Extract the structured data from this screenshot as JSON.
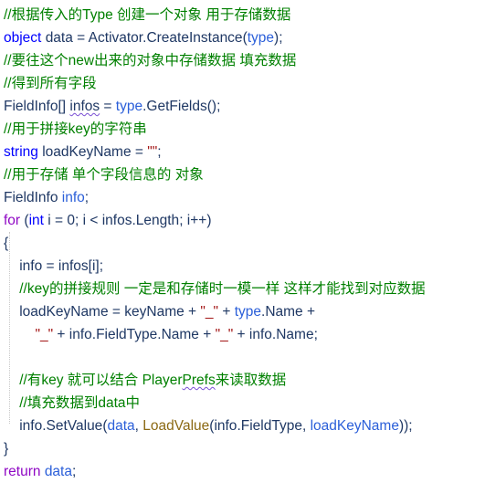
{
  "editor": {
    "language": "csharp",
    "background_color": "#ffffff",
    "colors": {
      "comment": "#008000",
      "keyword": "#0000ff",
      "control_keyword": "#8f08c4",
      "identifier": "#1f3864",
      "type_reference": "#2b5fd9",
      "string_literal": "#a31515",
      "method_call": "#8b6914",
      "squiggle_underline": "#7a4fd4",
      "indent_guide": "#c8c8c8"
    },
    "lines": [
      {
        "n": 1,
        "indent": 0,
        "text": "//根据传入的Type 创建一个对象 用于存储数据",
        "tokens": [
          {
            "t": "//根据传入的Type 创建一个对象 用于存储数据",
            "k": "cmt"
          }
        ]
      },
      {
        "n": 2,
        "indent": 0,
        "text": "object data = Activator.CreateInstance(type);",
        "tokens": [
          {
            "t": "object",
            "k": "kw"
          },
          {
            "t": " ",
            "k": "plain"
          },
          {
            "t": "data",
            "k": "id"
          },
          {
            "t": " = ",
            "k": "plain"
          },
          {
            "t": "Activator",
            "k": "type"
          },
          {
            "t": ".",
            "k": "punct"
          },
          {
            "t": "CreateInstance",
            "k": "id"
          },
          {
            "t": "(",
            "k": "punct"
          },
          {
            "t": "type",
            "k": "ltblue"
          },
          {
            "t": ");",
            "k": "punct"
          }
        ]
      },
      {
        "n": 3,
        "indent": 0,
        "text": "//要往这个new出来的对象中存储数据 填充数据",
        "tokens": [
          {
            "t": "//要往这个new出来的对象中存储数据 填充数据",
            "k": "cmt"
          }
        ]
      },
      {
        "n": 4,
        "indent": 0,
        "text": "//得到所有字段",
        "tokens": [
          {
            "t": "//得到所有字段",
            "k": "cmt"
          }
        ]
      },
      {
        "n": 5,
        "indent": 0,
        "text": "FieldInfo[] infos = type.GetFields();",
        "tokens": [
          {
            "t": "FieldInfo",
            "k": "type"
          },
          {
            "t": "[] ",
            "k": "punct"
          },
          {
            "t": "infos",
            "k": "id",
            "squiggle": true
          },
          {
            "t": " = ",
            "k": "plain"
          },
          {
            "t": "type",
            "k": "ltblue"
          },
          {
            "t": ".",
            "k": "punct"
          },
          {
            "t": "GetFields",
            "k": "id"
          },
          {
            "t": "();",
            "k": "punct"
          }
        ]
      },
      {
        "n": 6,
        "indent": 0,
        "text": "//用于拼接key的字符串",
        "tokens": [
          {
            "t": "//用于拼接key的字符串",
            "k": "cmt"
          }
        ]
      },
      {
        "n": 7,
        "indent": 0,
        "text": "string loadKeyName = \"\";",
        "tokens": [
          {
            "t": "string",
            "k": "kw"
          },
          {
            "t": " ",
            "k": "plain"
          },
          {
            "t": "loadKeyName",
            "k": "id"
          },
          {
            "t": " = ",
            "k": "plain"
          },
          {
            "t": "\"\"",
            "k": "str"
          },
          {
            "t": ";",
            "k": "punct"
          }
        ]
      },
      {
        "n": 8,
        "indent": 0,
        "text": "//用于存储 单个字段信息的 对象",
        "tokens": [
          {
            "t": "//用于存储 单个字段信息的 对象",
            "k": "cmt"
          }
        ]
      },
      {
        "n": 9,
        "indent": 0,
        "text": "FieldInfo info;",
        "tokens": [
          {
            "t": "FieldInfo",
            "k": "type"
          },
          {
            "t": " ",
            "k": "plain"
          },
          {
            "t": "info",
            "k": "ltblue"
          },
          {
            "t": ";",
            "k": "punct"
          }
        ]
      },
      {
        "n": 10,
        "indent": 0,
        "text": "for (int i = 0; i < infos.Length; i++)",
        "tokens": [
          {
            "t": "for",
            "k": "ctl"
          },
          {
            "t": " (",
            "k": "punct"
          },
          {
            "t": "int",
            "k": "kw"
          },
          {
            "t": " i = 0; i < ",
            "k": "plain"
          },
          {
            "t": "infos",
            "k": "id"
          },
          {
            "t": ".",
            "k": "punct"
          },
          {
            "t": "Length",
            "k": "id"
          },
          {
            "t": "; i++)",
            "k": "plain"
          }
        ]
      },
      {
        "n": 11,
        "indent": 0,
        "text": "{",
        "tokens": [
          {
            "t": "{",
            "k": "punct"
          }
        ]
      },
      {
        "n": 12,
        "indent": 1,
        "text": "info = infos[i];",
        "tokens": [
          {
            "t": "info",
            "k": "id"
          },
          {
            "t": " = ",
            "k": "plain"
          },
          {
            "t": "infos",
            "k": "id"
          },
          {
            "t": "[i];",
            "k": "punct"
          }
        ]
      },
      {
        "n": 13,
        "indent": 1,
        "text": "//key的拼接规则 一定是和存储时一模一样 这样才能找到对应数据",
        "tokens": [
          {
            "t": "//key的拼接规则 一定是和存储时一模一样 这样才能找到对应数据",
            "k": "cmt"
          }
        ]
      },
      {
        "n": 14,
        "indent": 1,
        "text": "loadKeyName = keyName + \"_\" + type.Name +",
        "tokens": [
          {
            "t": "loadKeyName",
            "k": "id"
          },
          {
            "t": " = ",
            "k": "plain"
          },
          {
            "t": "keyName",
            "k": "id"
          },
          {
            "t": " + ",
            "k": "plain"
          },
          {
            "t": "\"_\"",
            "k": "str"
          },
          {
            "t": " + ",
            "k": "plain"
          },
          {
            "t": "type",
            "k": "ltblue"
          },
          {
            "t": ".",
            "k": "punct"
          },
          {
            "t": "Name",
            "k": "id"
          },
          {
            "t": " +",
            "k": "plain"
          }
        ]
      },
      {
        "n": 15,
        "indent": 2,
        "text": "\"_\" + info.FieldType.Name + \"_\" + info.Name;",
        "tokens": [
          {
            "t": "\"_\"",
            "k": "str"
          },
          {
            "t": " + ",
            "k": "plain"
          },
          {
            "t": "info",
            "k": "id"
          },
          {
            "t": ".",
            "k": "punct"
          },
          {
            "t": "FieldType",
            "k": "id"
          },
          {
            "t": ".",
            "k": "punct"
          },
          {
            "t": "Name",
            "k": "id"
          },
          {
            "t": " + ",
            "k": "plain"
          },
          {
            "t": "\"_\"",
            "k": "str"
          },
          {
            "t": " + ",
            "k": "plain"
          },
          {
            "t": "info",
            "k": "id"
          },
          {
            "t": ".",
            "k": "punct"
          },
          {
            "t": "Name",
            "k": "id"
          },
          {
            "t": ";",
            "k": "punct"
          }
        ]
      },
      {
        "n": 16,
        "indent": 0,
        "text": "",
        "tokens": []
      },
      {
        "n": 17,
        "indent": 1,
        "text": "//有key 就可以结合 PlayerPrefs来读取数据",
        "tokens": [
          {
            "t": "//有key 就可以结合 Player",
            "k": "cmt"
          },
          {
            "t": "Prefs",
            "k": "cmt",
            "squiggle": true
          },
          {
            "t": "来读取数据",
            "k": "cmt"
          }
        ]
      },
      {
        "n": 18,
        "indent": 1,
        "text": "//填充数据到data中",
        "tokens": [
          {
            "t": "//填充数据到data中",
            "k": "cmt"
          }
        ]
      },
      {
        "n": 19,
        "indent": 1,
        "text": "info.SetValue(data, LoadValue(info.FieldType, loadKeyName));",
        "tokens": [
          {
            "t": "info",
            "k": "id"
          },
          {
            "t": ".",
            "k": "punct"
          },
          {
            "t": "SetValue",
            "k": "id"
          },
          {
            "t": "(",
            "k": "punct"
          },
          {
            "t": "data",
            "k": "ltblue"
          },
          {
            "t": ", ",
            "k": "punct"
          },
          {
            "t": "LoadValue",
            "k": "mth"
          },
          {
            "t": "(",
            "k": "punct"
          },
          {
            "t": "info",
            "k": "id"
          },
          {
            "t": ".",
            "k": "punct"
          },
          {
            "t": "FieldType",
            "k": "id"
          },
          {
            "t": ", ",
            "k": "punct"
          },
          {
            "t": "loadKeyName",
            "k": "ltblue"
          },
          {
            "t": "));",
            "k": "punct"
          }
        ]
      },
      {
        "n": 20,
        "indent": 0,
        "text": "}",
        "tokens": [
          {
            "t": "}",
            "k": "punct"
          }
        ]
      },
      {
        "n": 21,
        "indent": 0,
        "text": "return data;",
        "tokens": [
          {
            "t": "return",
            "k": "ctl"
          },
          {
            "t": " ",
            "k": "plain"
          },
          {
            "t": "data",
            "k": "ltblue"
          },
          {
            "t": ";",
            "k": "punct"
          }
        ]
      }
    ]
  }
}
